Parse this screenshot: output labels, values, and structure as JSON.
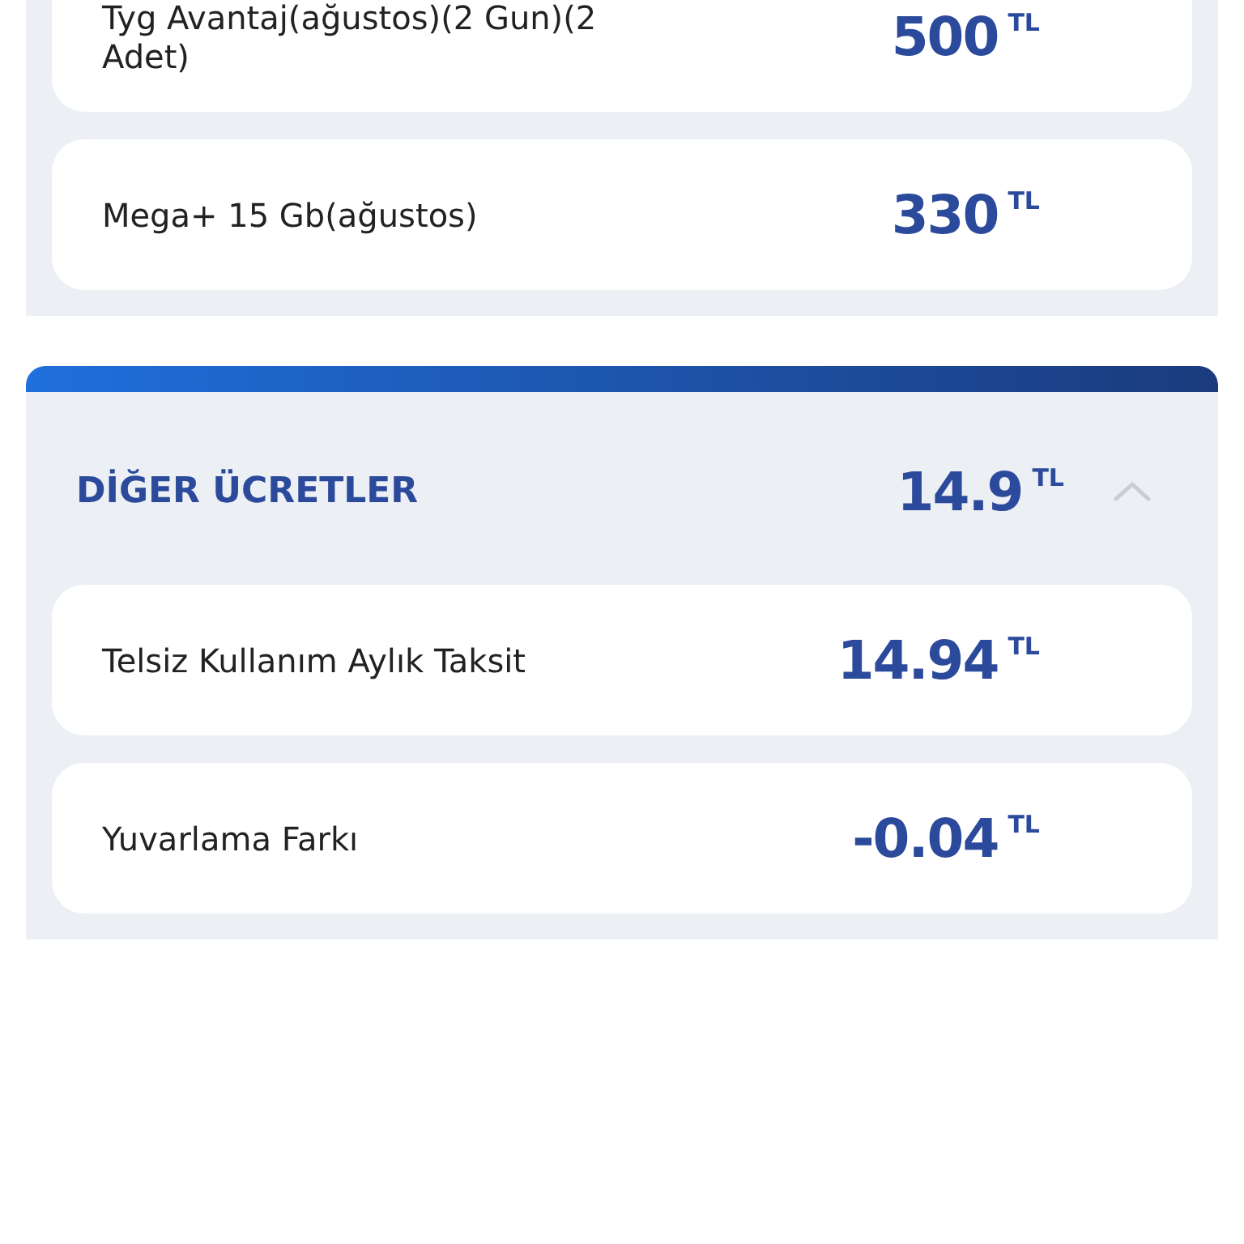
{
  "sections": [
    {
      "items": [
        {
          "label": "Tyg Avantaj(ağustos)(2 Gun)(2 Adet)",
          "amount": "500",
          "currency": "TL"
        },
        {
          "label": "Mega+ 15 Gb(ağustos)",
          "amount": "330",
          "currency": "TL"
        }
      ]
    },
    {
      "title": "DİĞER ÜCRETLER",
      "total": "14.9",
      "currency": "TL",
      "expanded": true,
      "items": [
        {
          "label": "Telsiz Kullanım Aylık Taksit",
          "amount": "14.94",
          "currency": "TL"
        },
        {
          "label": "Yuvarlama Farkı",
          "amount": "-0.04",
          "currency": "TL"
        }
      ]
    }
  ]
}
